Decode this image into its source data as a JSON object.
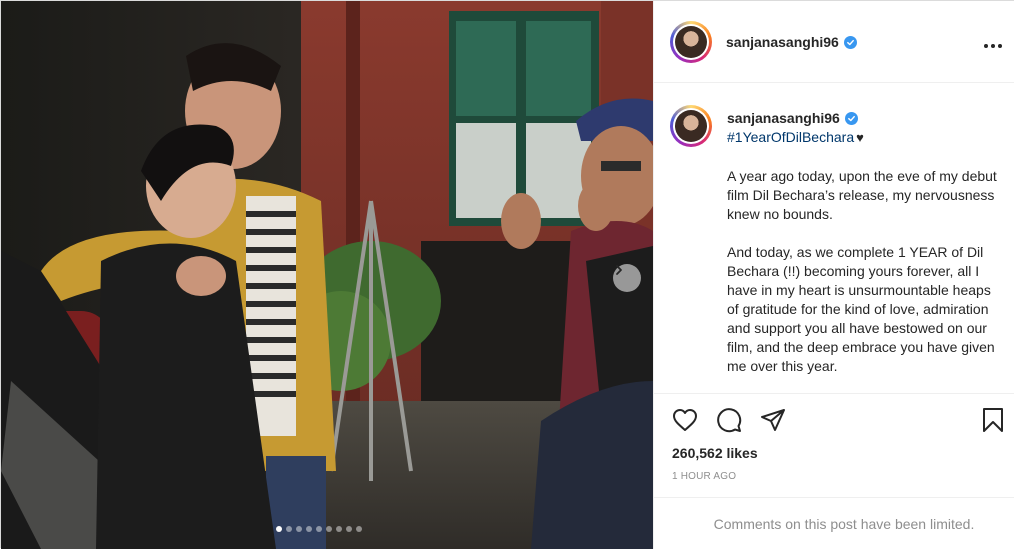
{
  "post": {
    "username": "sanjanasanghi96",
    "hashtag": "#1YearOfDilBechara",
    "hashtag_suffix": "♥",
    "caption_paragraphs": [
      "A year ago today, upon the eve of my debut film Dil Bechara’s release, my nervousness knew no bounds.",
      "And today, as we complete 1 YEAR of Dil Bechara (!!) becoming yours forever, all I have in my heart is unsurmountable heaps of gratitude for the kind of love, admiration and support you all have bestowed on our film, and the deep embrace you have given me over this year."
    ],
    "likes": "260,562 likes",
    "timestamp": "1 HOUR AGO",
    "comments_notice": "Comments on this post have been limited."
  },
  "carousel": {
    "total_slides": 9,
    "active_index": 0
  },
  "icons": {
    "more": "more-options-icon",
    "like": "heart-icon",
    "comment": "comment-icon",
    "share": "share-icon",
    "save": "bookmark-icon",
    "next": "chevron-right-icon",
    "verified": "verified-badge-icon"
  },
  "colors": {
    "verified": "#3897f0",
    "hashtag": "#00376b",
    "muted": "#8e8e8e",
    "text": "#262626"
  }
}
